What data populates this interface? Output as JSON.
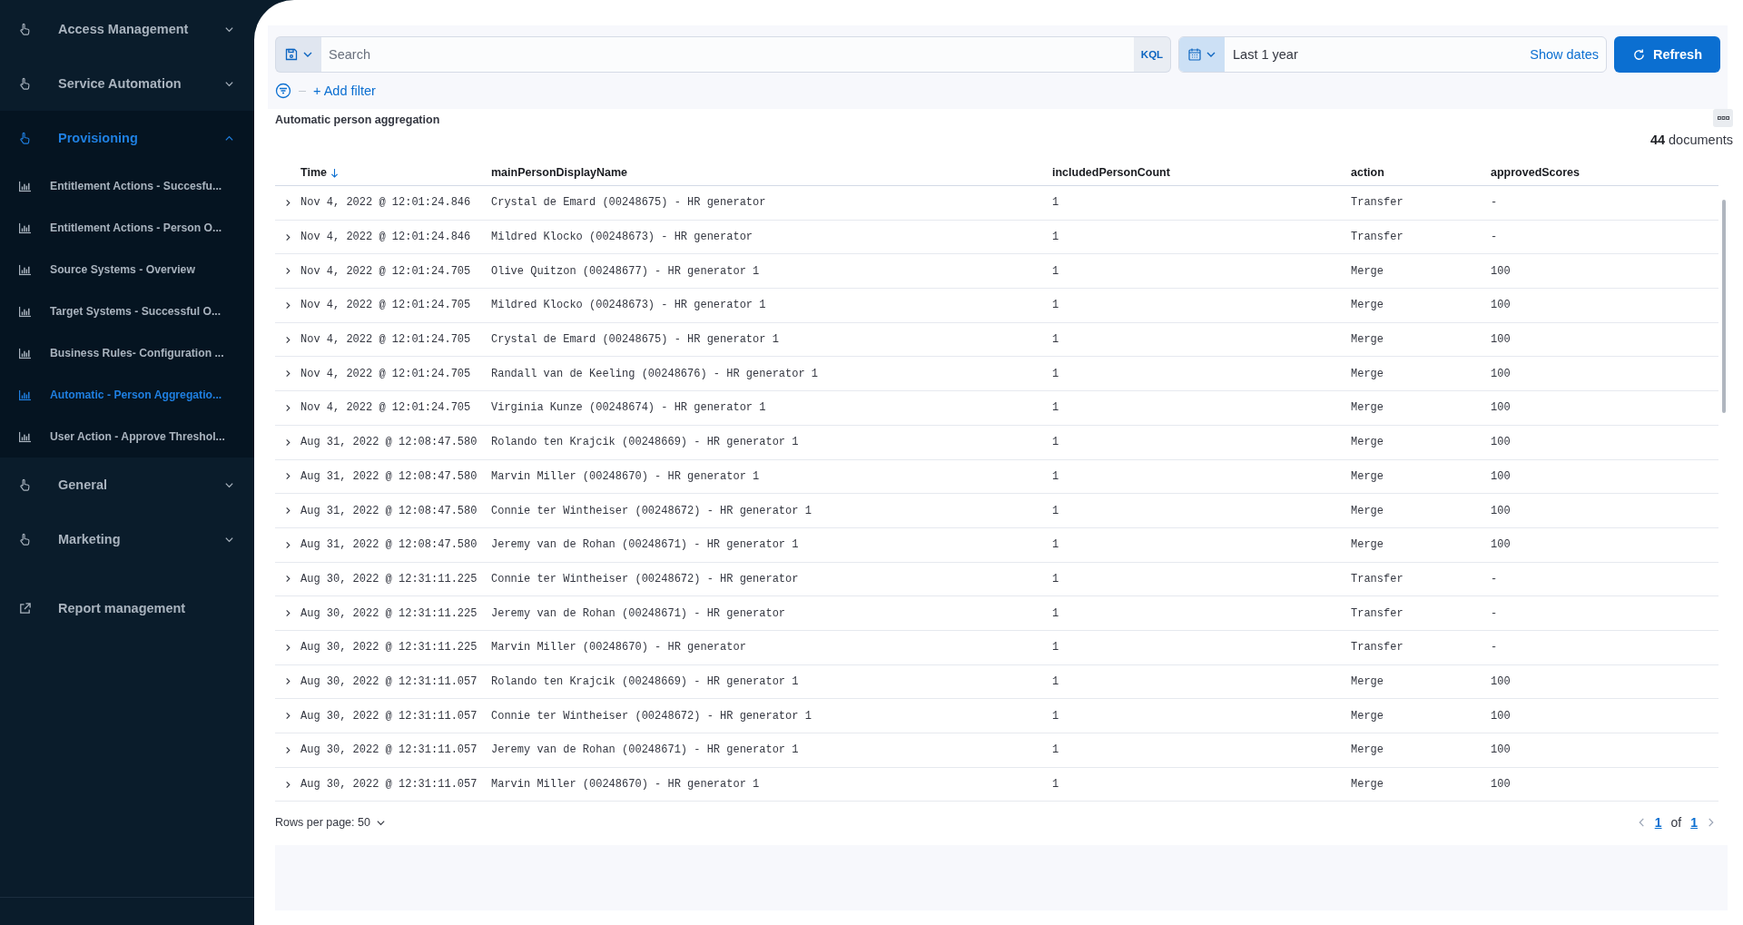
{
  "sidebar": {
    "groups": [
      {
        "kind": "menu",
        "label": "Access Management",
        "expanded": false,
        "selected": false
      },
      {
        "kind": "menu",
        "label": "Service Automation",
        "expanded": false,
        "selected": false
      },
      {
        "kind": "menu",
        "label": "Provisioning",
        "expanded": true,
        "selected": true,
        "children": [
          {
            "label": "Entitlement Actions - Succesfu...",
            "selected": false
          },
          {
            "label": "Entitlement Actions - Person O...",
            "selected": false
          },
          {
            "label": "Source Systems - Overview",
            "selected": false
          },
          {
            "label": "Target Systems - Successful O...",
            "selected": false
          },
          {
            "label": "Business Rules- Configuration ...",
            "selected": false
          },
          {
            "label": "Automatic - Person Aggregatio...",
            "selected": true
          },
          {
            "label": "User Action - Approve Threshol...",
            "selected": false
          }
        ]
      },
      {
        "kind": "menu",
        "label": "General",
        "expanded": false,
        "selected": false
      },
      {
        "kind": "menu",
        "label": "Marketing",
        "expanded": false,
        "selected": false
      },
      {
        "kind": "link",
        "label": "Report management",
        "selected": false
      }
    ]
  },
  "query": {
    "search_placeholder": "Search",
    "language": "KQL",
    "time_range": "Last 1 year",
    "show_dates": "Show dates",
    "refresh": "Refresh",
    "add_filter": "+ Add filter"
  },
  "panel": {
    "title": "Automatic person aggregation",
    "hits_count": "44",
    "hits_label": "documents",
    "columns": [
      {
        "label": "Time",
        "sorted": true
      },
      {
        "label": "mainPersonDisplayName",
        "sorted": false
      },
      {
        "label": "includedPersonCount",
        "sorted": false
      },
      {
        "label": "action",
        "sorted": false
      },
      {
        "label": "approvedScores",
        "sorted": false
      }
    ],
    "rows": [
      [
        "Nov 4, 2022 @ 12:01:24.846",
        "Crystal de Emard (00248675) - HR generator",
        "1",
        "Transfer",
        "-"
      ],
      [
        "Nov 4, 2022 @ 12:01:24.846",
        "Mildred Klocko (00248673) - HR generator",
        "1",
        "Transfer",
        "-"
      ],
      [
        "Nov 4, 2022 @ 12:01:24.705",
        "Olive Quitzon (00248677) - HR generator 1",
        "1",
        "Merge",
        "100"
      ],
      [
        "Nov 4, 2022 @ 12:01:24.705",
        "Mildred Klocko (00248673) - HR generator 1",
        "1",
        "Merge",
        "100"
      ],
      [
        "Nov 4, 2022 @ 12:01:24.705",
        "Crystal de Emard (00248675) - HR generator 1",
        "1",
        "Merge",
        "100"
      ],
      [
        "Nov 4, 2022 @ 12:01:24.705",
        "Randall van de Keeling (00248676) - HR generator 1",
        "1",
        "Merge",
        "100"
      ],
      [
        "Nov 4, 2022 @ 12:01:24.705",
        "Virginia Kunze (00248674) - HR generator 1",
        "1",
        "Merge",
        "100"
      ],
      [
        "Aug 31, 2022 @ 12:08:47.580",
        "Rolando ten Krajcik (00248669) - HR generator 1",
        "1",
        "Merge",
        "100"
      ],
      [
        "Aug 31, 2022 @ 12:08:47.580",
        "Marvin Miller (00248670) - HR generator 1",
        "1",
        "Merge",
        "100"
      ],
      [
        "Aug 31, 2022 @ 12:08:47.580",
        "Connie ter Wintheiser (00248672) - HR generator 1",
        "1",
        "Merge",
        "100"
      ],
      [
        "Aug 31, 2022 @ 12:08:47.580",
        "Jeremy van de Rohan (00248671) - HR generator 1",
        "1",
        "Merge",
        "100"
      ],
      [
        "Aug 30, 2022 @ 12:31:11.225",
        "Connie ter Wintheiser (00248672) - HR generator",
        "1",
        "Transfer",
        "-"
      ],
      [
        "Aug 30, 2022 @ 12:31:11.225",
        "Jeremy van de Rohan (00248671) - HR generator",
        "1",
        "Transfer",
        "-"
      ],
      [
        "Aug 30, 2022 @ 12:31:11.225",
        "Marvin Miller (00248670) - HR generator",
        "1",
        "Transfer",
        "-"
      ],
      [
        "Aug 30, 2022 @ 12:31:11.057",
        "Rolando ten Krajcik (00248669) - HR generator 1",
        "1",
        "Merge",
        "100"
      ],
      [
        "Aug 30, 2022 @ 12:31:11.057",
        "Connie ter Wintheiser (00248672) - HR generator 1",
        "1",
        "Merge",
        "100"
      ],
      [
        "Aug 30, 2022 @ 12:31:11.057",
        "Jeremy van de Rohan (00248671) - HR generator 1",
        "1",
        "Merge",
        "100"
      ],
      [
        "Aug 30, 2022 @ 12:31:11.057",
        "Marvin Miller (00248670) - HR generator 1",
        "1",
        "Merge",
        "100"
      ]
    ],
    "pagination": {
      "rows_per_page": "Rows per page: 50",
      "current": "1",
      "of": "of",
      "total": "1"
    }
  }
}
